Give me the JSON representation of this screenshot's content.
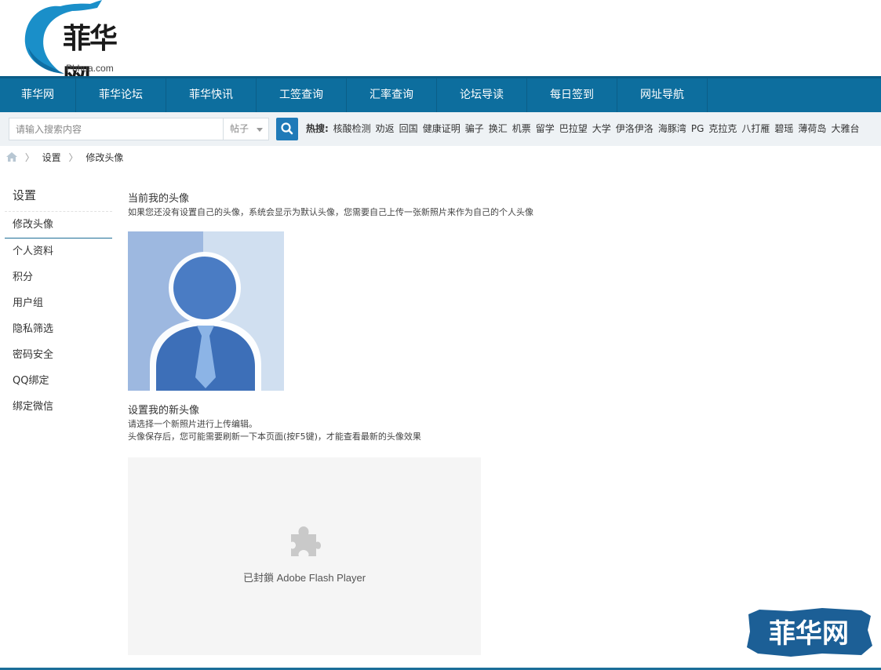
{
  "header": {
    "logo_text": "菲华网",
    "logo_sub": "Phhua.com"
  },
  "nav": {
    "items": [
      "菲华网",
      "菲华论坛",
      "菲华快讯",
      "工签查询",
      "汇率查询",
      "论坛导读",
      "每日签到",
      "网址导航"
    ]
  },
  "search": {
    "placeholder": "请输入搜索内容",
    "type": "帖子",
    "hot_label": "热搜:",
    "hot_items": [
      "核酸检测",
      "劝返",
      "回国",
      "健康证明",
      "骗子",
      "换汇",
      "机票",
      "留学",
      "巴拉望",
      "大学",
      "伊洛伊洛",
      "海豚湾",
      "PG",
      "克拉克",
      "八打雁",
      "碧瑶",
      "薄荷岛",
      "大雅台"
    ]
  },
  "breadcrumb": {
    "items": [
      "设置",
      "修改头像"
    ]
  },
  "sidebar": {
    "title": "设置",
    "items": [
      "修改头像",
      "个人资料",
      "积分",
      "用户组",
      "隐私筛选",
      "密码安全",
      "QQ绑定",
      "绑定微信"
    ]
  },
  "content": {
    "current_title": "当前我的头像",
    "current_desc": "如果您还没有设置自己的头像，系统会显示为默认头像，您需要自己上传一张新照片来作为自己的个人头像",
    "new_title": "设置我的新头像",
    "new_desc1": "请选择一个新照片进行上传编辑。",
    "new_desc2": "头像保存后，您可能需要刷新一下本页面(按F5键)，才能查看最新的头像效果",
    "flash_blocked": "已封鎖 Adobe Flash Player"
  },
  "watermark": {
    "text": "菲华网"
  },
  "colors": {
    "nav_bg": "#0d6e9e",
    "search_button": "#1f7ab8",
    "accent_line": "#1b6e99"
  }
}
